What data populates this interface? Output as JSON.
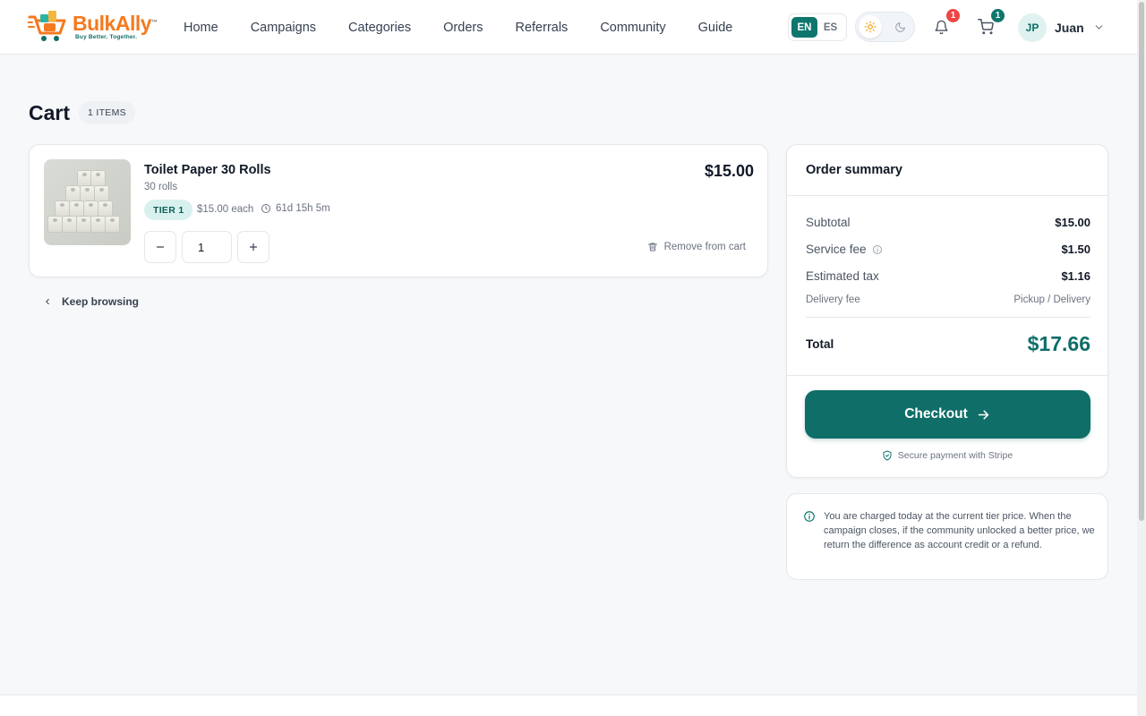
{
  "header": {
    "logo": {
      "word": "BulkAlly",
      "tm": "™",
      "tagline": "Buy Better. Together."
    },
    "nav": [
      "Home",
      "Campaigns",
      "Categories",
      "Orders",
      "Referrals",
      "Community",
      "Guide"
    ],
    "lang": {
      "active": "EN",
      "other": "ES"
    },
    "notifications_count": "1",
    "cart_count": "1",
    "user": {
      "initials": "JP",
      "name": "Juan"
    }
  },
  "cart": {
    "title": "Cart",
    "items_badge": "1 ITEMS",
    "item": {
      "name": "Toilet Paper 30 Rolls",
      "subtitle": "30 rolls",
      "tier": "TIER 1",
      "each_price": "$15.00 each",
      "time_left": "61d 15h 5m",
      "quantity": "1",
      "price": "$15.00",
      "remove_label": "Remove from cart"
    },
    "keep_browsing": "Keep browsing"
  },
  "summary": {
    "title": "Order summary",
    "subtotal_label": "Subtotal",
    "subtotal": "$15.00",
    "service_fee_label": "Service fee",
    "service_fee": "$1.50",
    "tax_label": "Estimated tax",
    "tax": "$1.16",
    "delivery_label": "Delivery fee",
    "delivery": "Pickup / Delivery",
    "total_label": "Total",
    "total": "$17.66",
    "checkout_label": "Checkout",
    "secure_label": "Secure payment with Stripe"
  },
  "info": {
    "text": "You are charged today at the current tier price. When the campaign closes, if the community unlocked a better price, we return the difference as account credit or a refund."
  },
  "colors": {
    "brand": "#0f6e68",
    "accent": "#f47a1f",
    "badge_red": "#ef4444"
  }
}
